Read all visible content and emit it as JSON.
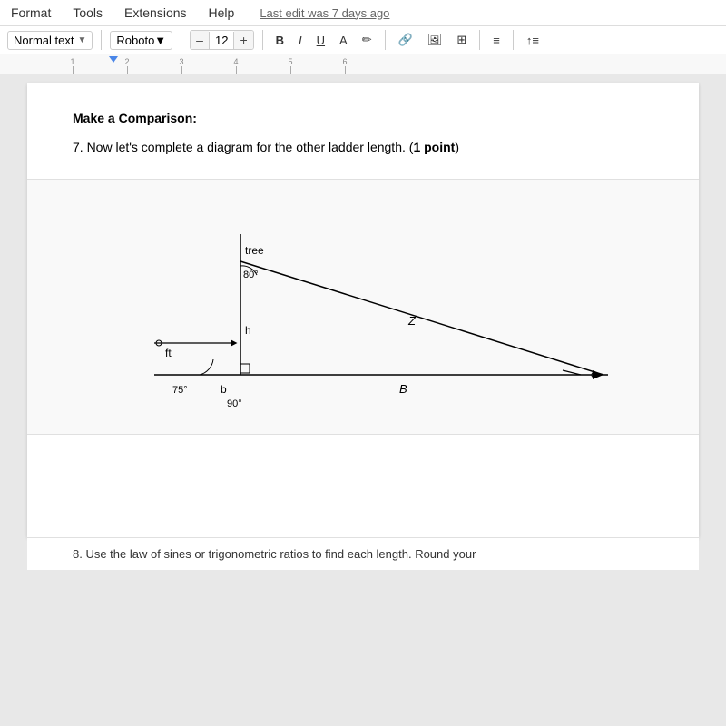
{
  "menubar": {
    "items": [
      "Format",
      "Tools",
      "Extensions",
      "Help"
    ],
    "last_edit": "Last edit was 7 days ago"
  },
  "toolbar": {
    "style_label": "Normal text",
    "font_label": "Roboto",
    "font_size": "12",
    "minus_label": "–",
    "plus_label": "+",
    "bold_label": "B",
    "italic_label": "I",
    "underline_label": "U",
    "align_icon": "≡",
    "indent_icon": "↑≡"
  },
  "ruler": {
    "marks": [
      "1",
      "2",
      "3",
      "4",
      "5",
      "6"
    ]
  },
  "content": {
    "section_title": "Make a Comparison:",
    "question": "7. Now let's complete a diagram for the other ladder length. (",
    "question_bold": "1 point",
    "question_end": ")",
    "diagram": {
      "labels": {
        "tree": "tree",
        "angle_80": "80°",
        "side_z": "Z",
        "side_ft": "ft",
        "side_h": "h",
        "side_b": "b",
        "angle_75": "75°",
        "side_B": "B",
        "angle_90": "90°",
        "small_circle_left": "°",
        "small_circle_right": "°"
      }
    },
    "bottom_text": "8. Use the law of sines or trigonometric ratios to find each length. Round your"
  }
}
